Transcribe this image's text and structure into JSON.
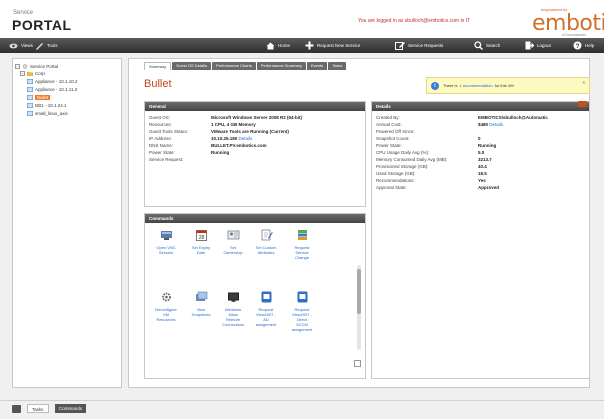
{
  "header": {
    "brand_small": "Service",
    "brand_big": "PORTAL",
    "login_text": "You are logged in as sbulloch@embotics.com in IT",
    "logo_tagline": "empowered by",
    "logo_text": "embotics",
    "logo_product": "vCommander"
  },
  "toolbar": {
    "views": "Views",
    "tools": "Tools",
    "home": "Home",
    "request_new_service": "Request New Service",
    "service_requests": "Service Requests",
    "search": "Search",
    "logout": "Logout",
    "help": "Help"
  },
  "tree": {
    "root": "Service Portal",
    "items": [
      {
        "label": "Corp"
      },
      {
        "label": "Appliance - 10.1.10.2"
      },
      {
        "label": "Appliance - 10.1.11.2"
      },
      {
        "label": "Bullet"
      },
      {
        "label": "DB1 - 10.1.24.1"
      },
      {
        "label": "small_linux_axis"
      }
    ]
  },
  "tabs": [
    {
      "label": "Summary"
    },
    {
      "label": "Guest OS Details"
    },
    {
      "label": "Performance Charts"
    },
    {
      "label": "Performance Summary"
    },
    {
      "label": "Events"
    },
    {
      "label": "Tasks"
    }
  ],
  "vm_name": "Bullet",
  "notice": {
    "prefix": "There is",
    "link": "1 recommendation",
    "suffix": "for this VM",
    "close": "x"
  },
  "general": {
    "title": "General",
    "rows": [
      {
        "label": "Guest OS:",
        "value": "Microsoft Windows Server 2008 R2 (64-bit)"
      },
      {
        "label": "Resources:",
        "value": "1 CPU, 4 GB Memory"
      },
      {
        "label": "Guest Tools Status:",
        "value": "VMware Tools are Running (Current)"
      },
      {
        "label": "IP Address:",
        "value": "10.10.25.180",
        "link": "Details"
      },
      {
        "label": "DNS Name:",
        "value": "BULLET.PV.embotics.com"
      },
      {
        "label": "Power State:",
        "value": "Running"
      },
      {
        "label": "Service Request:",
        "value": ""
      }
    ]
  },
  "details": {
    "title": "Details",
    "rows": [
      {
        "label": "Created By:",
        "value": "EMBOTICS\\sbulloch@Automatic"
      },
      {
        "label": "Annual Cost:",
        "value": "$480",
        "link": "Details"
      },
      {
        "label": "Powered Off Since:",
        "value": ""
      },
      {
        "label": "Snapshot Count:",
        "value": "0"
      },
      {
        "label": "Power State:",
        "value": "Running"
      },
      {
        "label": "CPU Usage Daily Avg (%):",
        "value": "5.0"
      },
      {
        "label": "Memory Consumed Daily Avg (MB):",
        "value": "3213.7"
      },
      {
        "label": "Provisioned Storage (GB):",
        "value": "40.4"
      },
      {
        "label": "Used Storage (GB):",
        "value": "18.5"
      },
      {
        "label": "Recommendations:",
        "value": "Yes"
      },
      {
        "label": "Approval State:",
        "value": "Approved"
      }
    ]
  },
  "commands": {
    "title": "Commands",
    "items": [
      {
        "label": "Open VNC Session",
        "icon": "vnc-icon"
      },
      {
        "label": "Set Expiry Date",
        "icon": "calendar-icon"
      },
      {
        "label": "Set Ownership",
        "icon": "ownership-icon"
      },
      {
        "label": "Set Custom Attributes",
        "icon": "attributes-icon"
      },
      {
        "label": "Request Service Change",
        "icon": "change-request-icon"
      },
      {
        "label": "Reconfigure VM Resources",
        "icon": "reconfigure-icon"
      },
      {
        "label": "View Snapshots",
        "icon": "snapshots-icon"
      },
      {
        "label": "Windows Allow Remote Connections",
        "icon": "remote-icon"
      },
      {
        "label": "Request View2007 - AD assignment",
        "icon": "ad-icon"
      },
      {
        "label": "Request View2007 - Direct SCCM assignment",
        "icon": "sccm-icon"
      }
    ]
  },
  "bottom": {
    "tasks": "Tasks",
    "commands": "Commands"
  }
}
